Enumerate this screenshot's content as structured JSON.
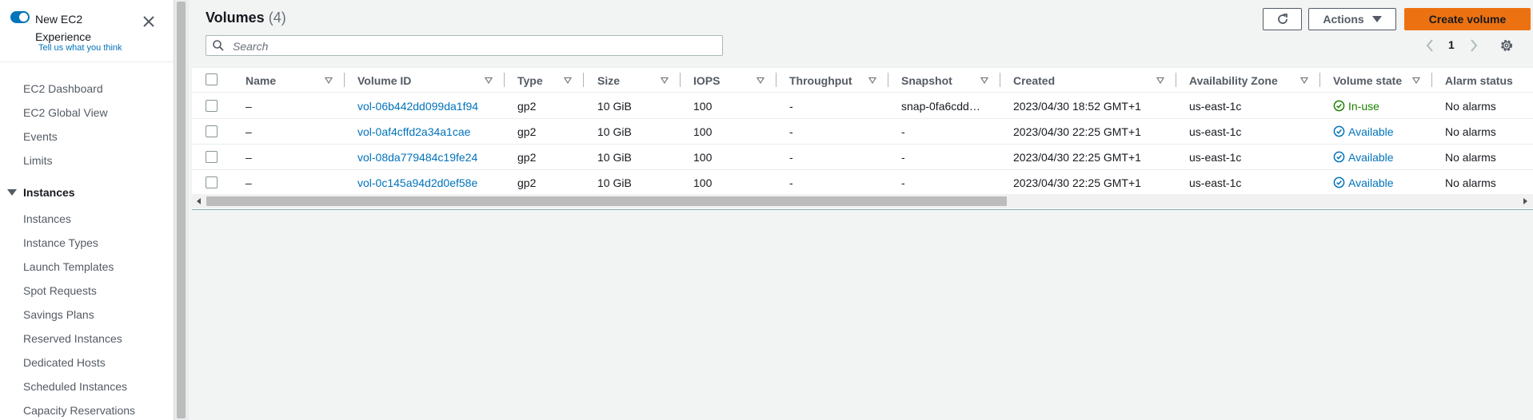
{
  "sidebar": {
    "new_experience_title": "New EC2 Experience",
    "new_experience_link": "Tell us what you think",
    "top_items": [
      {
        "label": "EC2 Dashboard"
      },
      {
        "label": "EC2 Global View"
      },
      {
        "label": "Events"
      },
      {
        "label": "Limits"
      }
    ],
    "section_title": "Instances",
    "section_items": [
      {
        "label": "Instances"
      },
      {
        "label": "Instance Types"
      },
      {
        "label": "Launch Templates"
      },
      {
        "label": "Spot Requests"
      },
      {
        "label": "Savings Plans"
      },
      {
        "label": "Reserved Instances"
      },
      {
        "label": "Dedicated Hosts"
      },
      {
        "label": "Scheduled Instances"
      },
      {
        "label": "Capacity Reservations"
      }
    ]
  },
  "header": {
    "title": "Volumes",
    "count": "(4)",
    "actions_label": "Actions",
    "create_label": "Create volume"
  },
  "search": {
    "placeholder": "Search"
  },
  "pagination": {
    "current_page": "1"
  },
  "table": {
    "columns": {
      "name": "Name",
      "volume_id": "Volume ID",
      "type": "Type",
      "size": "Size",
      "iops": "IOPS",
      "throughput": "Throughput",
      "snapshot": "Snapshot",
      "created": "Created",
      "az": "Availability Zone",
      "state": "Volume state",
      "alarm": "Alarm status"
    },
    "rows": [
      {
        "name": "–",
        "volume_id": "vol-06b442dd099da1f94",
        "type": "gp2",
        "size": "10 GiB",
        "iops": "100",
        "throughput": "-",
        "snapshot": "snap-0fa6cdd…",
        "created": "2023/04/30 18:52 GMT+1",
        "az": "us-east-1c",
        "state": "In-use",
        "alarm": "No alarms"
      },
      {
        "name": "–",
        "volume_id": "vol-0af4cffd2a34a1cae",
        "type": "gp2",
        "size": "10 GiB",
        "iops": "100",
        "throughput": "-",
        "snapshot": "-",
        "created": "2023/04/30 22:25 GMT+1",
        "az": "us-east-1c",
        "state": "Available",
        "alarm": "No alarms"
      },
      {
        "name": "–",
        "volume_id": "vol-08da779484c19fe24",
        "type": "gp2",
        "size": "10 GiB",
        "iops": "100",
        "throughput": "-",
        "snapshot": "-",
        "created": "2023/04/30 22:25 GMT+1",
        "az": "us-east-1c",
        "state": "Available",
        "alarm": "No alarms"
      },
      {
        "name": "–",
        "volume_id": "vol-0c145a94d2d0ef58e",
        "type": "gp2",
        "size": "10 GiB",
        "iops": "100",
        "throughput": "-",
        "snapshot": "-",
        "created": "2023/04/30 22:25 GMT+1",
        "az": "us-east-1c",
        "state": "Available",
        "alarm": "No alarms"
      }
    ]
  },
  "colors": {
    "accent_orange": "#ec7211",
    "link_blue": "#0073bb",
    "in_use_green": "#1d8102"
  },
  "icons": {
    "refresh": "refresh-icon",
    "settings": "gear-icon",
    "search": "search-icon",
    "close": "close-icon",
    "state_in_use": "check-circle-icon",
    "state_available": "check-circle-icon"
  }
}
